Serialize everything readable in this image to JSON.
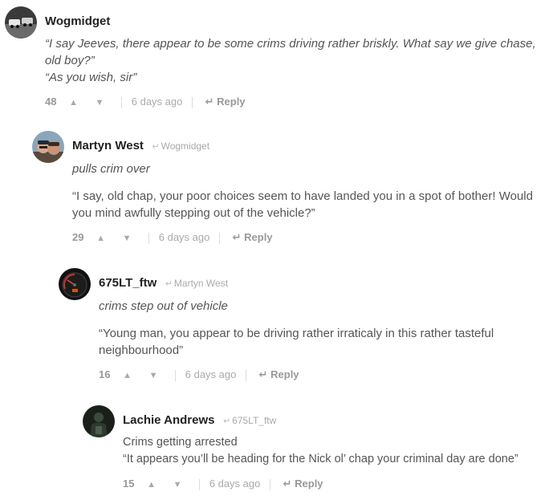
{
  "comments": [
    {
      "author": "Wogmidget",
      "reply_to": "",
      "lines": [
        "“I say Jeeves, there appear to be some crims driving rather briskly. What say we give chase, old boy?”",
        "“As you wish, sir”"
      ],
      "score": "48",
      "time": "6 days ago",
      "reply_label": "Reply"
    },
    {
      "author": "Martyn West",
      "reply_to": "Wogmidget",
      "action": "pulls crim over",
      "quote": "“I say, old chap, your poor choices seem to have landed you in a spot of bother! Would you mind awfully stepping out of the vehicle?”",
      "score": "29",
      "time": "6 days ago",
      "reply_label": "Reply"
    },
    {
      "author": "675LT_ftw",
      "reply_to": "Martyn West",
      "action": "crims step out of vehicle",
      "quote": "“Young man, you appear to be driving rather irraticaly in this rather tasteful neighbourhood”",
      "score": "16",
      "time": "6 days ago",
      "reply_label": "Reply"
    },
    {
      "author": "Lachie Andrews",
      "reply_to": "675LT_ftw",
      "lines": [
        "Crims getting arrested",
        "“It appears you’ll be heading for the Nick ol’ chap your criminal day are done”"
      ],
      "score": "15",
      "time": "6 days ago",
      "reply_label": "Reply"
    }
  ],
  "icons": {
    "upvote": "▲",
    "downvote": "▼",
    "reply_arrow": "↵"
  }
}
